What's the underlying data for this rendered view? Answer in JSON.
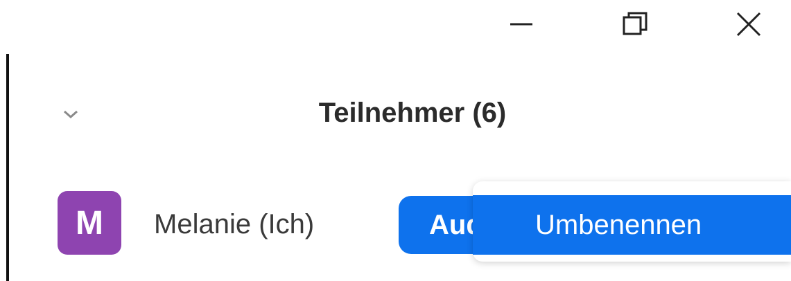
{
  "window_controls": {
    "minimize_icon": "minimize-icon",
    "restore_icon": "restore-icon",
    "close_icon": "close-icon"
  },
  "header": {
    "title": "Teilnehmer (6)",
    "collapse_icon": "chevron-down-icon"
  },
  "participant": {
    "avatar_letter": "M",
    "avatar_color": "#8e44b0",
    "name": "Melanie (Ich)",
    "action_label": "Audio stummschalten",
    "action_color": "#0e72ed"
  },
  "context_menu": {
    "items": [
      {
        "label": "Umbenennen",
        "highlighted": true
      }
    ]
  }
}
